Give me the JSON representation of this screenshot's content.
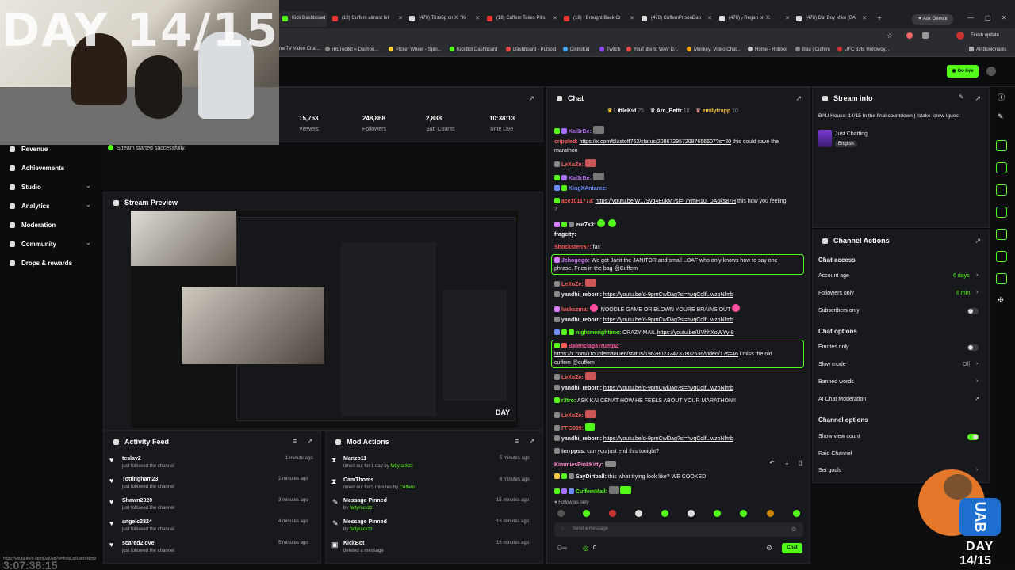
{
  "browser": {
    "tabs": [
      {
        "label": "Kick Dashboard"
      },
      {
        "label": "(18) Cuffem almost fell"
      },
      {
        "label": "(479) Triss5p on X: \"Ki"
      },
      {
        "label": "(18) Cuffem Takes Pills"
      },
      {
        "label": "(18) I Brought Back Cr"
      },
      {
        "label": "(478) CuffemPrisonDao"
      },
      {
        "label": "(478) ᵥ Regan on X:"
      },
      {
        "label": "(478) Dat Boy Mike (BA"
      }
    ],
    "ask_gemini": "Ask Gemini",
    "finish_update": "Finish update",
    "bookmarks": [
      "meTV Video Chat...",
      "IRLToolkit » Dashbo...",
      "Picker Wheel - Spin...",
      "KickBot Dashboard",
      "Dashboard - Pulsoid",
      "DistroKid",
      "Twitch",
      "YouTube to WAV D...",
      "Monkey: Video Chat...",
      "Home - Roblox",
      "Bau | Cuffem",
      "UFC 326: Hollowoy..."
    ],
    "all_bookmarks": "All Bookmarks"
  },
  "overlay": {
    "day_text": "DAY 14/15",
    "corner_day": "DAY",
    "corner_num": "14/15",
    "bottom_timer": "3:07:38:15",
    "status_url": "https://youtu.be/d-9pmCwl0ag?si=hvqColfLiwzoNlmb"
  },
  "go_live": "Go live",
  "sidebar": {
    "items": [
      {
        "label": "Revenue",
        "chev": ""
      },
      {
        "label": "Achievements",
        "chev": ""
      },
      {
        "label": "Studio",
        "chev": "⌄"
      },
      {
        "label": "Analytics",
        "chev": "⌄"
      },
      {
        "label": "Moderation",
        "chev": ""
      },
      {
        "label": "Community",
        "chev": "⌄"
      },
      {
        "label": "Drops & rewards",
        "chev": ""
      }
    ]
  },
  "stats": [
    {
      "value": "15,763",
      "label": "Viewers"
    },
    {
      "value": "248,868",
      "label": "Followers"
    },
    {
      "value": "2,838",
      "label": "Sub Counts"
    },
    {
      "value": "10:38:13",
      "label": "Time Live"
    }
  ],
  "toast": "Stream started successfully.",
  "stream_preview": {
    "title": "Stream Preview"
  },
  "activity_feed": {
    "title": "Activity Feed",
    "items": [
      {
        "name": "teslav2",
        "action": "just followed the channel",
        "ago": "1 minute ago"
      },
      {
        "name": "Tottingham23",
        "action": "just followed the channel",
        "ago": "2 minutes ago"
      },
      {
        "name": "Shawn2020",
        "action": "just followed the channel",
        "ago": "3 minutes ago"
      },
      {
        "name": "angelc2824",
        "action": "just followed the channel",
        "ago": "4 minutes ago"
      },
      {
        "name": "scared2love",
        "action": "just followed the channel",
        "ago": "5 minutes ago"
      }
    ]
  },
  "mod_actions": {
    "title": "Mod Actions",
    "items": [
      {
        "name": "Manzo11",
        "detail_prefix": "timed out for 1 day by ",
        "by": "fattyrackzz",
        "ago": "5 minutes ago"
      },
      {
        "name": "CamThoms",
        "detail_prefix": "timed out for 5 minutes by ",
        "by": "Cuffem",
        "ago": "6 minutes ago"
      },
      {
        "name": "Message Pinned",
        "detail_prefix": "by ",
        "by": "fattyrackzz",
        "ago": "15 minutes ago"
      },
      {
        "name": "Message Pinned",
        "detail_prefix": "by ",
        "by": "fattyrackzz",
        "ago": "16 minutes ago"
      },
      {
        "name": "KickBot",
        "detail_prefix": "deleted a message",
        "by": "",
        "ago": "16 minutes ago"
      }
    ]
  },
  "chat": {
    "title": "Chat",
    "top_gifters": [
      {
        "name": "LittleKid",
        "count": "25"
      },
      {
        "name": "Arc_Bettr",
        "count": "10"
      },
      {
        "name": "emilytrapp",
        "count": "10"
      }
    ],
    "messages": [
      {
        "user": "Kai3rBe:",
        "color": "#b36cf0",
        "text": "",
        "link": ""
      },
      {
        "user": "crippled:",
        "color": "#ff5b5b",
        "text": "this could save the",
        "link": "https://x.com/blastoff762/status/2086729572087656607?s=20"
      },
      {
        "user": "",
        "color": "#ffffff",
        "text": "marathon",
        "link": ""
      },
      {
        "user": "LeXoZe:",
        "color": "#ff5b5b",
        "text": "",
        "link": ""
      },
      {
        "user": "Kai3rBe:",
        "color": "#b36cf0",
        "text": "",
        "link": ""
      },
      {
        "user": "KingXAntarez:",
        "color": "#6d8cff",
        "text": "",
        "link": ""
      },
      {
        "user": "ace1011773:",
        "color": "#ff5b5b",
        "text": "this how you feeling",
        "link": "https://youtu.be/W179vq4EukM?si=-7YmH10_DA6ks87H"
      },
      {
        "user": "",
        "color": "#ffffff",
        "text": "?",
        "link": ""
      },
      {
        "user": "eur7×3:",
        "color": "#ffffff",
        "text": "",
        "link": ""
      },
      {
        "user": "fragcity:",
        "color": "#ffffff",
        "text": "",
        "link": ""
      },
      {
        "user": "Shocksterr67:",
        "color": "#ff5b5b",
        "text": "fax",
        "link": ""
      },
      {
        "user": "Jchogogo:",
        "color": "#d47bff",
        "text": "We got Janit the JANITOR and small LOAF who only knows how to say one",
        "link": ""
      },
      {
        "user": "",
        "color": "#ffffff",
        "text": "phrase. Fries in the bag     @Cuffem",
        "link": ""
      },
      {
        "user": "LeXoZe:",
        "color": "#ff5b5b",
        "text": "",
        "link": ""
      },
      {
        "user": "yandhi_reborn:",
        "color": "#efeff1",
        "text": "",
        "link": "https://youtu.be/d-9pmCwl0ag?si=hvqColfLiwzoNlmb"
      },
      {
        "user": "luckszma:",
        "color": "#ff5b5b",
        "text": "NOODLE GAME OR BLOWN YOURE BRAINS OUT",
        "link": ""
      },
      {
        "user": "yandhi_reborn:",
        "color": "#efeff1",
        "text": "",
        "link": "https://youtu.be/d-9pmCwl0ag?si=hvqColfLiwzoNlmb"
      },
      {
        "user": "nightmerightime:",
        "color": "#53fc18",
        "text": "CRAZY MAIL",
        "link": "https://youtu.be/UVhhXoWYy-8"
      },
      {
        "user": "BalenciagaTrump2:",
        "color": "#ff5b9e",
        "text": "",
        "link": ""
      },
      {
        "user": "",
        "color": "#ffffff",
        "text": "i miss the old",
        "link": "https://x.com/TroublemanDeo/status/1962802324737802536/video/1?s=46"
      },
      {
        "user": "",
        "color": "#ffffff",
        "text": "cuffem @cuffem",
        "link": ""
      },
      {
        "user": "LeXoZe:",
        "color": "#ff5b5b",
        "text": "",
        "link": ""
      },
      {
        "user": "yandhi_reborn:",
        "color": "#efeff1",
        "text": "",
        "link": "https://youtu.be/d-9pmCwl0ag?si=hvqColfLiwzoNlmb"
      },
      {
        "user": "r3tro:",
        "color": "#53fc18",
        "text": "ASK KAI CENAT HOW HE FEELS ABOUT YOUR MARATHON!!",
        "link": ""
      },
      {
        "user": "LeXoZe:",
        "color": "#ff5b5b",
        "text": "",
        "link": ""
      },
      {
        "user": "FFG999:",
        "color": "#ff5b5b",
        "text": "",
        "link": ""
      },
      {
        "user": "yandhi_reborn:",
        "color": "#efeff1",
        "text": "",
        "link": "https://youtu.be/d-9pmCwl0ag?si=hvqColfLiwzoNlmb"
      },
      {
        "user": "terrppss:",
        "color": "#efeff1",
        "text": "can you just end this tonight?",
        "link": ""
      },
      {
        "user": "KimmiesPinkKitty:",
        "color": "#ff8fd0",
        "text": "",
        "link": ""
      },
      {
        "user": "SayDirtball:",
        "color": "#efeff1",
        "text": "this what trying look like? WE COOKED",
        "link": ""
      },
      {
        "user": "CuffemMail:",
        "color": "#53fc18",
        "text": "",
        "link": ""
      }
    ],
    "followers_only": "Followers only",
    "placeholder": "Send a message",
    "points": "0",
    "send": "Chat"
  },
  "stream_info": {
    "title": "Stream info",
    "stream_title": "BAU House: 14/15 In the final countdown | !stake !crew !guest",
    "category": "Just Chatting",
    "language": "English"
  },
  "channel_actions": {
    "title": "Channel Actions",
    "chat_access": "Chat access",
    "account_age": {
      "label": "Account age",
      "value": "6 days"
    },
    "followers_only": {
      "label": "Followers only",
      "value": "6 min"
    },
    "subscribers_only": {
      "label": "Subscribers only",
      "on": false
    },
    "chat_options": "Chat options",
    "emotes_only": {
      "label": "Emotes only",
      "on": false
    },
    "slow_mode": {
      "label": "Slow mode",
      "value": "Off"
    },
    "banned_words": "Banned words",
    "ai_moderation": "AI Chat Moderation",
    "channel_options": "Channel options",
    "show_view_count": {
      "label": "Show view count",
      "on": true
    },
    "raid_channel": "Raid Channel",
    "set_goals": "Set goals"
  },
  "mascot": {
    "jersey": "UAB"
  },
  "colors": {
    "accent": "#53fc18",
    "bg": "#0e0e10",
    "panel": "#18191d"
  }
}
